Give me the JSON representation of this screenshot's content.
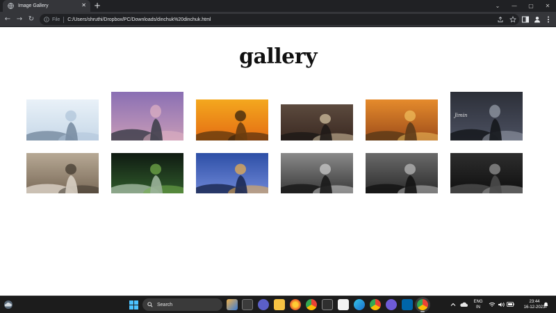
{
  "browser": {
    "tab_title": "Image Gallery",
    "tab_close": "✕",
    "new_tab": "+",
    "file_label": "File",
    "url": "C:/Users/shruthi/Dropbox/PC/Downloads/dinchuk%20dinchuk.html",
    "controls": {
      "minimize": "—",
      "maximize": "▢",
      "close": "✕",
      "tab_list": "⌄"
    },
    "nav": {
      "back": "←",
      "forward": "→",
      "reload": "↻"
    }
  },
  "page": {
    "title": "gallery",
    "images": [
      {
        "name": "man-white-shirt-window",
        "palette": [
          "#e9f1f8",
          "#c7d8e8",
          "#aec3d8",
          "#7a8ea3"
        ]
      },
      {
        "name": "snowy-mountains-pink-sky",
        "palette": [
          "#8a6fb4",
          "#c79bb7",
          "#e0b2c3",
          "#40404c"
        ]
      },
      {
        "name": "sunset-silhouette",
        "palette": [
          "#f4a81e",
          "#e46d13",
          "#2a1b0d",
          "#6b3d0e"
        ]
      },
      {
        "name": "anime-character-brown",
        "palette": [
          "#5c4a3e",
          "#3b2a22",
          "#d9c7a5",
          "#1f1a17"
        ]
      },
      {
        "name": "anime-autumn-forest",
        "palette": [
          "#e58b2c",
          "#9e4d1a",
          "#f1c15e",
          "#5e3b18"
        ]
      },
      {
        "name": "man-black-outfit-poster",
        "palette": [
          "#2c2f38",
          "#4b5060",
          "#9aa1ad",
          "#15171c"
        ],
        "caption": "Jimin"
      },
      {
        "name": "man-hat-street",
        "palette": [
          "#b7a995",
          "#7a6a58",
          "#3d342b",
          "#d8cfc3"
        ]
      },
      {
        "name": "anime-green-eyes",
        "palette": [
          "#0f1a12",
          "#2f5a2a",
          "#76b04c",
          "#9bb39a"
        ]
      },
      {
        "name": "anime-blue-sky-clouds",
        "palette": [
          "#2d4fa6",
          "#6d86d6",
          "#f2b24a",
          "#1c2a55"
        ]
      },
      {
        "name": "man-black-white-1",
        "palette": [
          "#8a8a8a",
          "#3a3a3a",
          "#d0d0d0",
          "#1a1a1a"
        ]
      },
      {
        "name": "man-black-white-2",
        "palette": [
          "#6a6a6a",
          "#2c2c2c",
          "#bdbdbd",
          "#141414"
        ]
      },
      {
        "name": "man-black-white-3",
        "palette": [
          "#2e2e2e",
          "#0f0f0f",
          "#9a9a9a",
          "#4a4a4a"
        ]
      }
    ]
  },
  "taskbar": {
    "search_label": "Search",
    "lang_top": "ENG",
    "lang_bottom": "IN",
    "time": "23:44",
    "date": "16-12-2023",
    "accent": "#0078d4"
  }
}
